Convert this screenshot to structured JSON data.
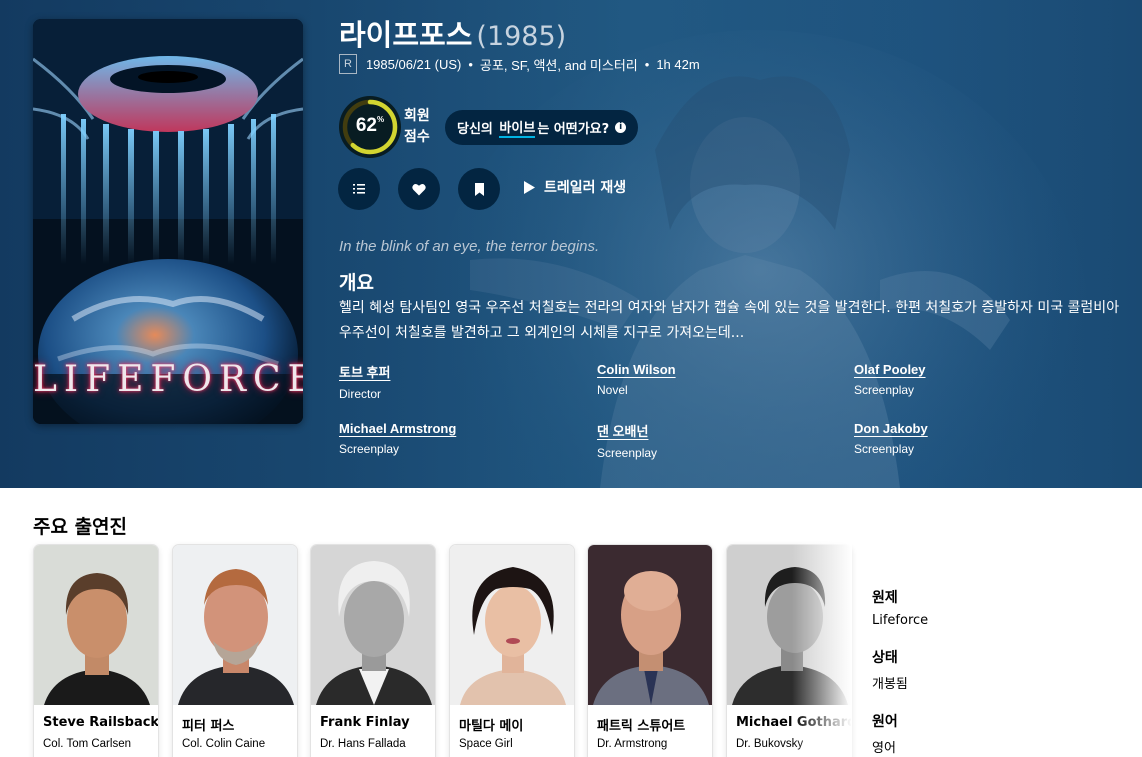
{
  "movie": {
    "title": "라이프포스",
    "year": "(1985)",
    "certification": "R",
    "release": "1985/06/21 (US)",
    "genres": "공포, SF, 액션, and 미스터리",
    "runtime": "1h 42m",
    "poster_logo": "LIFEFORCE"
  },
  "score": {
    "value": "62",
    "percent_sign": "%",
    "percent": 62,
    "label_line1": "회원",
    "label_line2": "점수",
    "ring_color": "#d2d531",
    "track_color": "#423d0f"
  },
  "vibe": {
    "before": "당신의",
    "link": "바이브",
    "after": "는 어떤가요?",
    "info_icon": "info-icon"
  },
  "actions": {
    "list_icon": "list-icon",
    "favorite_icon": "heart-icon",
    "watchlist_icon": "bookmark-icon",
    "trailer_label": "트레일러 재생"
  },
  "tagline": "In the blink of an eye, the terror begins.",
  "overview": {
    "heading": "개요",
    "text": "헬리 혜성 탐사팀인 영국 우주선 처칠호는 전라의 여자와 남자가 캡슐 속에 있는 것을 발견한다. 한편 처칠호가 증발하자 미국 콜럼비아 우주선이 처칠호를 발견하고 그 외계인의 시체를 지구로 가져오는데..."
  },
  "crew": [
    {
      "name": "토브 후퍼",
      "job": "Director"
    },
    {
      "name": "Colin Wilson",
      "job": "Novel"
    },
    {
      "name": "Olaf Pooley",
      "job": "Screenplay"
    },
    {
      "name": "Michael Armstrong",
      "job": "Screenplay"
    },
    {
      "name": "댄 오배넌",
      "job": "Screenplay"
    },
    {
      "name": "Don Jakoby",
      "job": "Screenplay"
    }
  ],
  "cast": {
    "heading": "주요 출연진",
    "members": [
      {
        "name": "Steve Railsback",
        "character": "Col. Tom Carlsen"
      },
      {
        "name": "피터 퍼스",
        "character": "Col. Colin Caine"
      },
      {
        "name": "Frank Finlay",
        "character": "Dr. Hans Fallada"
      },
      {
        "name": "마틸다 메이",
        "character": "Space Girl"
      },
      {
        "name": "패트릭 스튜어트",
        "character": "Dr. Armstrong"
      },
      {
        "name": "Michael Gothard",
        "character": "Dr. Bukovsky"
      }
    ]
  },
  "facts": [
    {
      "label": "원제",
      "value": "Lifeforce"
    },
    {
      "label": "상태",
      "value": "개봉됨"
    },
    {
      "label": "원어",
      "value": "영어"
    }
  ]
}
